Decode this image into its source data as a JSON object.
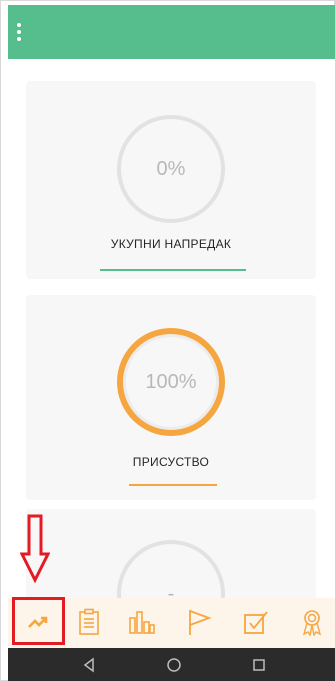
{
  "app_bar": {
    "menu_icon": "more-vert-icon",
    "color": "#56bd8c"
  },
  "cards": [
    {
      "value": "0%",
      "label": "УКУПНИ НАПРЕДАК",
      "accent": "#56bd8c"
    },
    {
      "value": "100%",
      "label": "ПРИСУСТВО",
      "accent": "#f5a641"
    },
    {
      "value": "-"
    }
  ],
  "bottom_nav": {
    "items": [
      "trending-up-icon",
      "clipboard-icon",
      "bar-chart-icon",
      "flag-icon",
      "checkbox-icon",
      "award-icon"
    ],
    "active": "trending-up-icon",
    "color": "#f5a641"
  },
  "system_nav": [
    "back-icon",
    "home-icon",
    "recents-icon"
  ],
  "annotation": {
    "color": "#e31b23"
  }
}
